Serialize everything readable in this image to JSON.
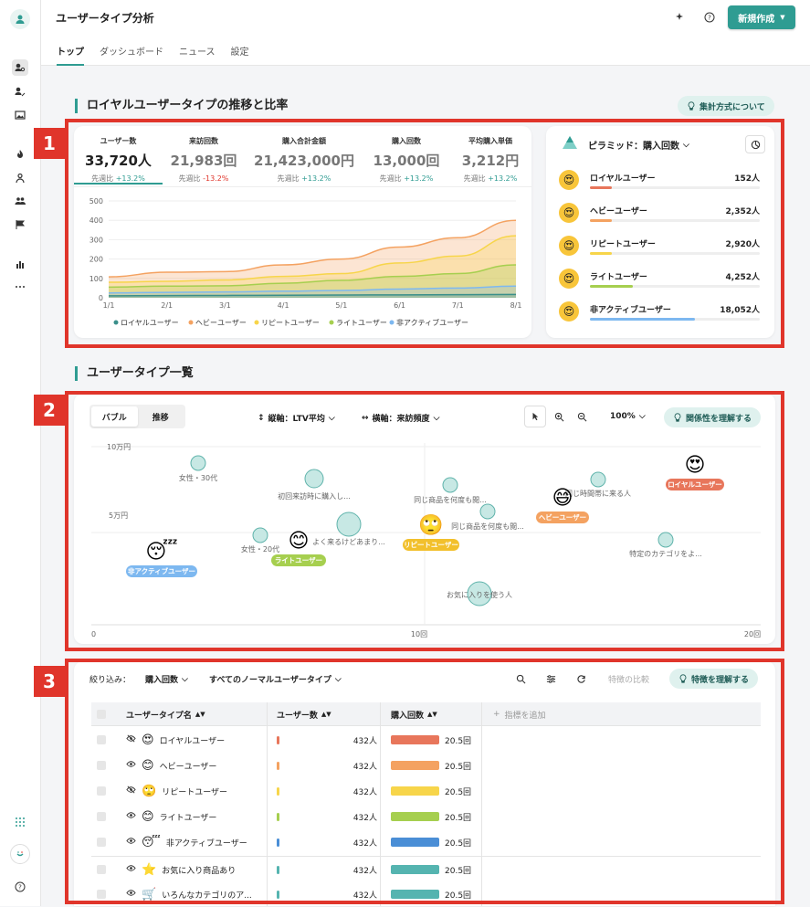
{
  "app_title": "ユーザータイプ分析",
  "new_button": "新規作成",
  "tabs": [
    "トップ",
    "ダッシュボード",
    "ニュース",
    "設定"
  ],
  "section1": {
    "title": "ロイヤルユーザータイプの推移と比率",
    "help_button": "集計方式について",
    "metrics": [
      {
        "label": "ユーザー数",
        "value": "33,720人",
        "prefix": "先週比",
        "change": "+13.2%",
        "dir": "up"
      },
      {
        "label": "来訪回数",
        "value": "21,983回",
        "prefix": "先週比",
        "change": "-13.2%",
        "dir": "down"
      },
      {
        "label": "購入合計金額",
        "value": "21,423,000円",
        "prefix": "先週比",
        "change": "+13.2%",
        "dir": "up"
      },
      {
        "label": "購入回数",
        "value": "13,000回",
        "prefix": "先週比",
        "change": "+13.2%",
        "dir": "up"
      },
      {
        "label": "平均購入単価",
        "value": "3,212円",
        "prefix": "先週比",
        "change": "+13.2%",
        "dir": "up"
      }
    ],
    "pyramid_title": "ピラミッド：購入回数",
    "pyramid": [
      {
        "name": "ロイヤルユーザー",
        "count": "152人",
        "ratio": 0.13,
        "color": "#e8765b"
      },
      {
        "name": "ヘビーユーザー",
        "count": "2,352人",
        "ratio": 0.13,
        "color": "#f4a261"
      },
      {
        "name": "リピートユーザー",
        "count": "2,920人",
        "ratio": 0.13,
        "color": "#f7d54a"
      },
      {
        "name": "ライトユーザー",
        "count": "4,252人",
        "ratio": 0.25,
        "color": "#a6cf4f"
      },
      {
        "name": "非アクティブユーザー",
        "count": "18,052人",
        "ratio": 0.62,
        "color": "#7db8f0"
      }
    ]
  },
  "chart_data": {
    "type": "area",
    "x": [
      "1/1",
      "2/1",
      "3/1",
      "4/1",
      "5/1",
      "6/1",
      "7/1",
      "8/1"
    ],
    "ylim": [
      0,
      500
    ],
    "yticks": [
      0,
      100,
      200,
      300,
      400,
      500
    ],
    "series": [
      {
        "name": "ロイヤルユーザー",
        "color": "#3a8f8a",
        "values": [
          10,
          11,
          12,
          13,
          14,
          15,
          16,
          17
        ]
      },
      {
        "name": "ヘビーユーザー",
        "color": "#f4a261",
        "values": [
          108,
          132,
          135,
          170,
          200,
          262,
          310,
          400
        ]
      },
      {
        "name": "リピートユーザー",
        "color": "#f7d54a",
        "values": [
          80,
          85,
          92,
          110,
          125,
          180,
          215,
          320
        ]
      },
      {
        "name": "ライトユーザー",
        "color": "#a6cf4f",
        "values": [
          55,
          60,
          62,
          75,
          90,
          110,
          125,
          170
        ]
      },
      {
        "name": "非アクティブユーザー",
        "color": "#7db8f0",
        "values": [
          25,
          28,
          30,
          34,
          38,
          45,
          50,
          60
        ]
      }
    ]
  },
  "section2": {
    "title": "ユーザータイプ一覧",
    "toggle": [
      "バブル",
      "推移"
    ],
    "y_axis_select": "縦軸：LTV平均",
    "x_axis_select": "横軸：来訪頻度",
    "zoom": "100%",
    "relation_button": "関係性を理解する",
    "y_labels": [
      "10万円",
      "5万円"
    ],
    "x_labels": [
      "0",
      "10回",
      "20回"
    ],
    "bubbles": [
      {
        "label": "女性・30代"
      },
      {
        "label": "初回来訪時に購入し..."
      },
      {
        "label": "女性・20代"
      },
      {
        "label": "よく来るけどあまり..."
      },
      {
        "label": "お気に入りを使う人"
      },
      {
        "label": "同じ商品を何度も閲..."
      },
      {
        "label": "同じ商品を何度も閲..."
      },
      {
        "label": "同じ時間帯に来る人"
      },
      {
        "label": "特定のカテゴリをよ..."
      }
    ],
    "type_badges": [
      {
        "label": "非アクティブユーザー",
        "color": "#7db8f0"
      },
      {
        "label": "ライトユーザー",
        "color": "#a6cf4f"
      },
      {
        "label": "リピートユーザー",
        "color": "#f2c02c"
      },
      {
        "label": "ヘビーユーザー",
        "color": "#f4a261"
      },
      {
        "label": "ロイヤルユーザー",
        "color": "#e8765b"
      }
    ]
  },
  "section3": {
    "filter_label": "絞り込み：",
    "filter_metric": "購入回数",
    "filter_scope": "すべてのノーマルユーザータイプ",
    "compare_button": "特徴の比較",
    "understand_button": "特徴を理解する",
    "columns": [
      "ユーザータイプ名",
      "ユーザー数",
      "購入回数"
    ],
    "add_metric": "指標を追加",
    "rows": [
      {
        "name": "ロイヤルユーザー",
        "users": "432人",
        "purchases": "20.5回",
        "color": "#e8765b",
        "hidden": true
      },
      {
        "name": "ヘビーユーザー",
        "users": "432人",
        "purchases": "20.5回",
        "color": "#f4a261",
        "hidden": false
      },
      {
        "name": "リピートユーザー",
        "users": "432人",
        "purchases": "20.5回",
        "color": "#f7d54a",
        "hidden": true
      },
      {
        "name": "ライトユーザー",
        "users": "432人",
        "purchases": "20.5回",
        "color": "#a6cf4f",
        "hidden": false
      },
      {
        "name": "非アクティブユーザー",
        "users": "432人",
        "purchases": "20.5回",
        "color": "#4a8ed6",
        "hidden": false
      },
      {
        "name": "お気に入り商品あり",
        "users": "432人",
        "purchases": "20.5回",
        "color": "#55b4b0",
        "hidden": false
      },
      {
        "name": "いろんなカテゴリのア...",
        "users": "432人",
        "purchases": "20.5回",
        "color": "#55b4b0",
        "hidden": false
      }
    ]
  },
  "annotations": [
    "1",
    "2",
    "3"
  ]
}
